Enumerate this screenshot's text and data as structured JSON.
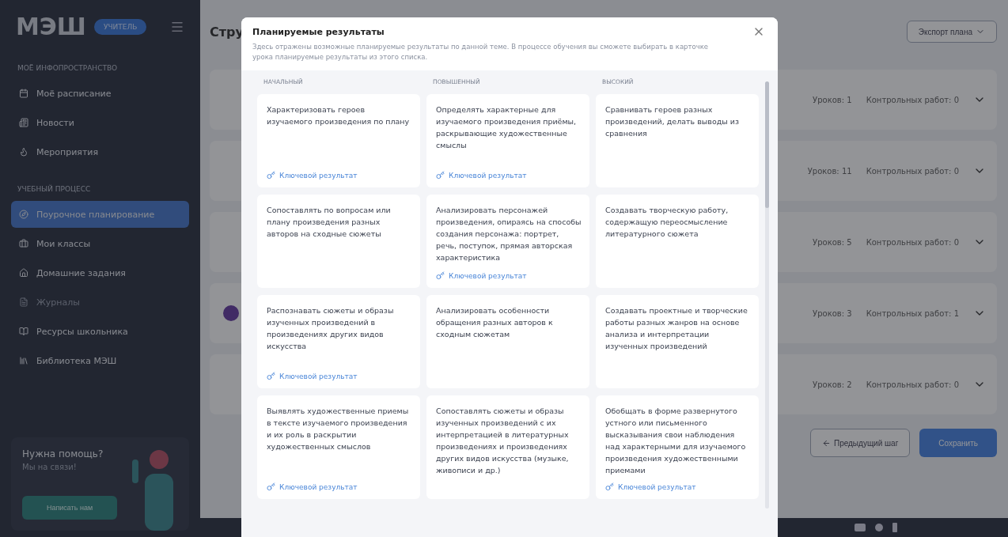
{
  "sidebar": {
    "logo": "МЭШ",
    "badge": "УЧИТЕЛЬ",
    "sections": [
      {
        "title": "МОЁ ИНФОПРОСТРАНСТВО",
        "items": [
          {
            "label": "Моё расписание",
            "selected": false,
            "disabled": false
          },
          {
            "label": "Новости",
            "selected": false,
            "disabled": false
          },
          {
            "label": "Мероприятия",
            "selected": false,
            "disabled": false
          }
        ]
      },
      {
        "title": "УЧЕБНЫЙ ПРОЦЕСС",
        "items": [
          {
            "label": "Поурочное планирование",
            "selected": true,
            "disabled": false
          },
          {
            "label": "Мои классы",
            "selected": false,
            "disabled": false
          },
          {
            "label": "Домашние задания",
            "selected": false,
            "disabled": false
          },
          {
            "label": "Журналы",
            "selected": false,
            "disabled": true
          },
          {
            "label": "Ресурсы школьника",
            "selected": false,
            "disabled": false
          },
          {
            "label": "Библиотека МЭШ",
            "selected": false,
            "disabled": false
          }
        ]
      }
    ],
    "help": {
      "title": "Нужна помощь?",
      "subtitle": "Мы на связи!",
      "button": "Написать нам"
    }
  },
  "page": {
    "title": "Стру",
    "export_button": "Экспорт плана",
    "modules": [
      {
        "lessons": "Уроков: 1",
        "tests": "Контрольных работ: 0"
      },
      {
        "lessons": "Уроков: 11",
        "tests": "Контрольных работ: 0"
      },
      {
        "lessons": "Уроков: 5",
        "tests": "Контрольных работ: 0"
      },
      {
        "lessons": "Уроков: 3",
        "tests": "Контрольных работ: 1"
      },
      {
        "lessons": "Уроков: 2",
        "tests": "Контрольных работ: 0"
      }
    ],
    "prev_button": "Предыдущий шаг",
    "save_button": "Сохранить"
  },
  "modal": {
    "title": "Планируемые результаты",
    "description": "Здесь отражены возможные планируемые результаты по данной теме. В процессе обучения вы сможете выбирать в карточке урока планируемые результаты из этого списка.",
    "columns": [
      "НАЧАЛЬНЫЙ",
      "ПОВЫШЕННЫЙ",
      "ВЫСОКИЙ"
    ],
    "rows": [
      {
        "cards": [
          {
            "text": "Характеризовать героев изучаемого произведения по плану",
            "key": true,
            "key_label": "Ключевой результат"
          },
          {
            "text": "Определять характерные для изучаемого произведения приёмы, раскрывающие художественные смыслы",
            "key": true,
            "key_label": "Ключевой результат"
          },
          {
            "text": "Сравнивать героев разных произведений, делать выводы из сравнения",
            "key": false
          }
        ]
      },
      {
        "cards": [
          {
            "text": "Сопоставлять по вопросам или плану произведения разных авторов на сходные сюжеты",
            "key": false
          },
          {
            "text": "Анализировать персонажей произведения, опираясь на способы создания персонажа: портрет, речь, поступок, прямая авторская характеристика",
            "key": true,
            "key_label": "Ключевой результат"
          },
          {
            "text": "Создавать творческую работу, содержащую переосмысление литературного сюжета",
            "key": false
          }
        ]
      },
      {
        "cards": [
          {
            "text": "Распознавать сюжеты и образы изученных произведений в произведениях других видов искусства",
            "key": true,
            "key_label": "Ключевой результат"
          },
          {
            "text": "Анализировать особенности обращения разных авторов к сходным сюжетам",
            "key": false
          },
          {
            "text": "Создавать проектные и творческие работы разных жанров на основе анализа и интерпретации изученных произведений",
            "key": false
          }
        ]
      },
      {
        "cards": [
          {
            "text": "Выявлять художественные приемы в тексте изучаемого произведения и их роль в раскрытии художественных смыслов",
            "key": true,
            "key_label": "Ключевой результат"
          },
          {
            "text": "Сопоставлять сюжеты и образы изученных произведений с их интерпретацией в литературных произведениях и произведениях других видов искусства (музыке, живописи и др.)",
            "key": false
          },
          {
            "text": "Обобщать в форме развернутого устного или письменного высказывания свои наблюдения над характерными для изучаемого произведения художественными приемами",
            "key": true,
            "key_label": "Ключевой результат"
          }
        ]
      }
    ]
  }
}
